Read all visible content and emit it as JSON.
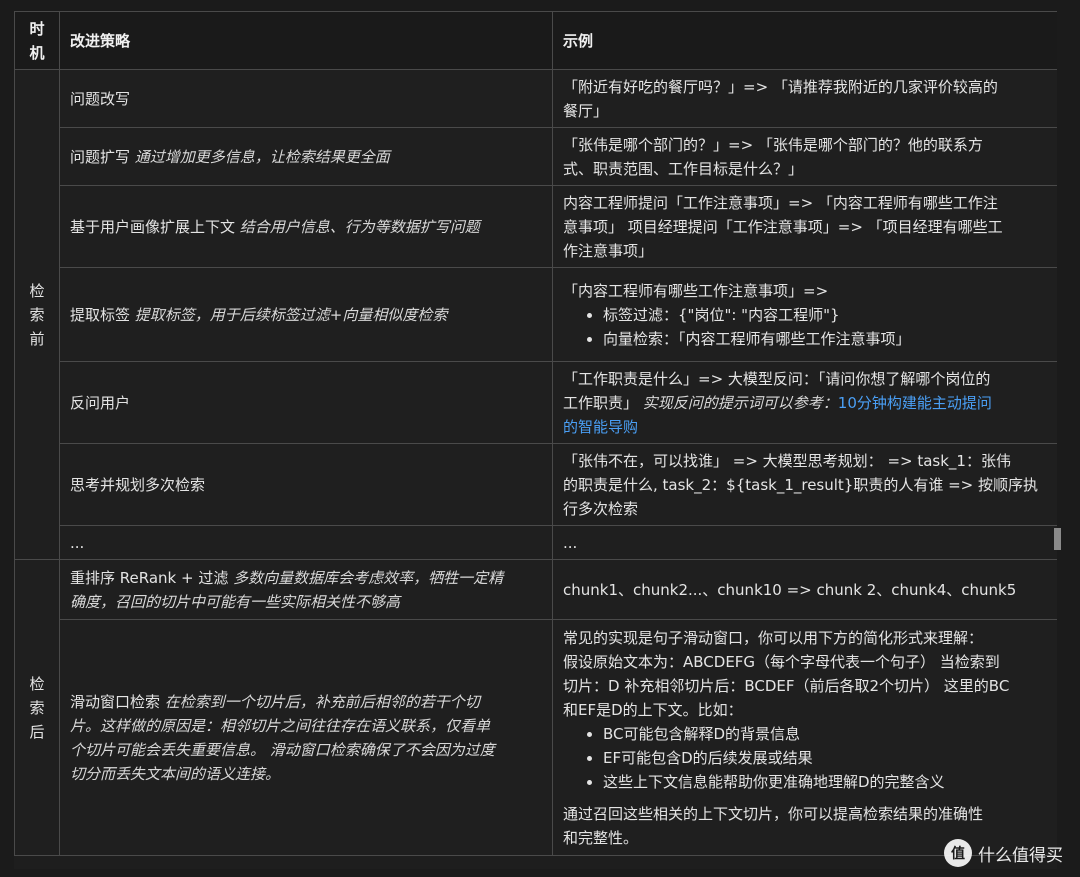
{
  "header": {
    "time": "时机",
    "strategy": "改进策略",
    "example": "示例"
  },
  "pre": {
    "label": "检索前",
    "rows": [
      {
        "name": "问题改写",
        "desc": "",
        "lines": [
          "「附近有好吃的餐厅吗？」=> 「请推荐我附近的几家评价较高的",
          "餐厅」"
        ]
      },
      {
        "name": "问题扩写",
        "desc": "通过增加更多信息，让检索结果更全面",
        "lines": [
          "「张伟是哪个部门的？」=> 「张伟是哪个部门的？他的联系方",
          "式、职责范围、工作目标是什么？」"
        ]
      },
      {
        "name": "基于用户画像扩展上下文",
        "desc": "结合用户信息、行为等数据扩写问题",
        "lines": [
          "内容工程师提问「工作注意事项」=> 「内容工程师有哪些工作注",
          "意事项」 项目经理提问「工作注意事项」=> 「项目经理有哪些工",
          "作注意事项」"
        ]
      },
      {
        "name": "提取标签",
        "desc": "提取标签，用于后续标签过滤+向量相似度检索",
        "lead": "「内容工程师有哪些工作注意事项」=>",
        "bullets": [
          "标签过滤：{\"岗位\": \"内容工程师\"}",
          "向量检索：「内容工程师有哪些工作注意事项」"
        ]
      },
      {
        "name": "反问用户",
        "desc": "",
        "line1": "「工作职责是什么」=> 大模型反问：「请问你想了解哪个岗位的",
        "line2_plain": "工作职责」 ",
        "line2_note": "实现反问的提示词可以参考：",
        "line2_link": "10分钟构建能主动提问",
        "line3_link": "的智能导购"
      },
      {
        "name": "思考并规划多次检索",
        "desc": "",
        "lines": [
          "「张伟不在，可以找谁」 => 大模型思考规划： => task_1：张伟",
          "的职责是什么, task_2：${task_1_result}职责的人有谁 => 按顺序执",
          "行多次检索"
        ]
      },
      {
        "name": "...",
        "desc": "",
        "lines": [
          "..."
        ]
      }
    ]
  },
  "post": {
    "label": "检索后",
    "rows": [
      {
        "name": "重排序 ReRank + 过滤",
        "desc1": "多数向量数据库会考虑效率，牺牲一定精",
        "desc2": "确度，召回的切片中可能有一些实际相关性不够高",
        "lines": [
          "chunk1、chunk2...、chunk10  => chunk 2、chunk4、chunk5"
        ]
      },
      {
        "name": "滑动窗口检索",
        "desc_lines": [
          "在检索到一个切片后，补充前后相邻的若干个切",
          "片。这样做的原因是：相邻切片之间往往存在语义联系，仅看单",
          "个切片可能会丢失重要信息。 滑动窗口检索确保了不会因为过度",
          "切分而丢失文本间的语义连接。"
        ],
        "lines": [
          "常见的实现是句子滑动窗口，你可以用下方的简化形式来理解：",
          "假设原始文本为：ABCDEFG（每个字母代表一个句子） 当检索到",
          "切片：D 补充相邻切片后：BCDEF（前后各取2个切片） 这里的BC",
          "和EF是D的上下文。比如："
        ],
        "bullets": [
          "BC可能包含解释D的背景信息",
          "EF可能包含D的后续发展或结果",
          "这些上下文信息能帮助你更准确地理解D的完整含义"
        ],
        "tail": [
          "通过召回这些相关的上下文切片，你可以提高检索结果的准确性",
          "和完整性。"
        ]
      }
    ]
  },
  "watermark": {
    "logo": "值",
    "text": "什么值得买"
  }
}
